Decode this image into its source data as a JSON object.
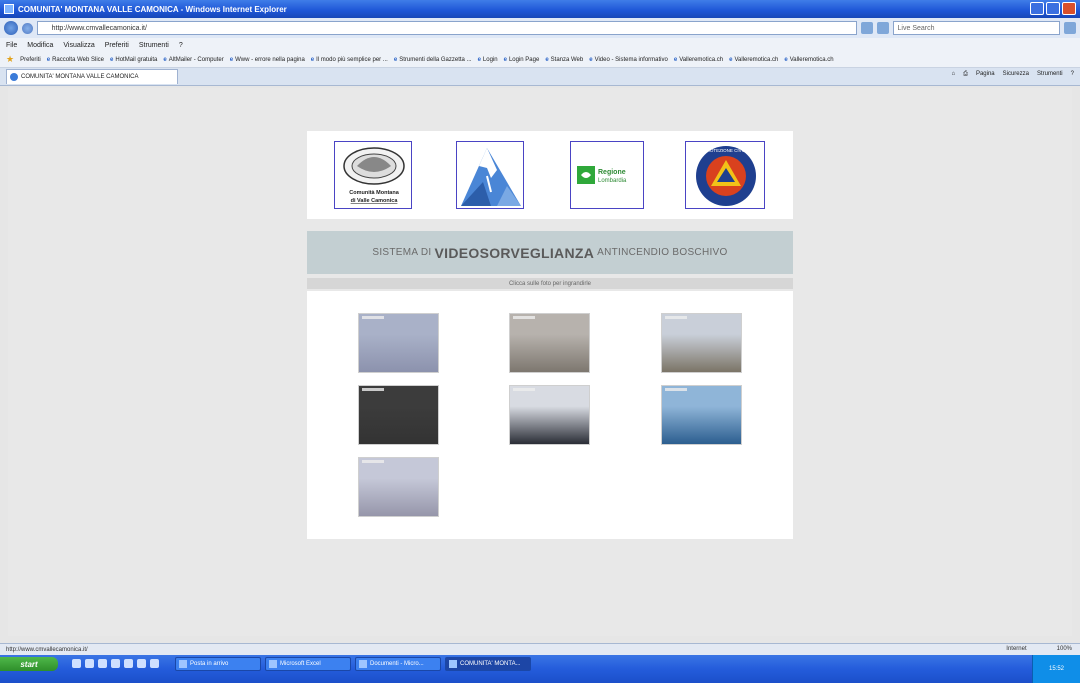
{
  "window": {
    "title": "COMUNITA' MONTANA VALLE CAMONICA - Windows Internet Explorer"
  },
  "address": {
    "url": "http://www.cmvallecamonica.it/",
    "search_placeholder": "Live Search"
  },
  "menu": [
    "File",
    "Modifica",
    "Visualizza",
    "Preferiti",
    "Strumenti",
    "?"
  ],
  "favorites": {
    "label": "Preferiti",
    "items": [
      "Raccolta Web Slice",
      "HotMail gratuita",
      "AltMailer - Computer",
      "Www - errore nella pagina",
      "Il modo più semplice per ...",
      "Strumenti della Gazzetta ...",
      "Login",
      "Login Page",
      "Stanza Web",
      "Video - Sistema informativo",
      "Valleremotica.ch",
      "Valleremotica.ch",
      "Valleremotica.ch"
    ]
  },
  "tab": {
    "label": "COMUNITA' MONTANA VALLE CAMONICA"
  },
  "command_bar": [
    "Pagina",
    "Sicurezza",
    "Strumenti"
  ],
  "page": {
    "banner": {
      "prefix": "SISTEMA DI",
      "emphasis": "VIDEOSORVEGLIANZA",
      "suffix": "ANTINCENDIO BOSCHIVO"
    },
    "hint": "Clicca sulle foto per ingrandirle",
    "logos": {
      "cm_line1": "Comunità Montana",
      "cm_line2": "di Valle Camonica",
      "rl_line1": "Regione",
      "rl_line2": "Lombardia",
      "pc_text": "PROTEZIONE CIVILE"
    },
    "cameras": [
      {
        "name": "camera-1",
        "sky": "#a9b1c8",
        "ground": "#8c92ad"
      },
      {
        "name": "camera-2",
        "sky": "#b7b2ad",
        "ground": "#7d776f"
      },
      {
        "name": "camera-3",
        "sky": "#c9cfd9",
        "ground": "#7b7466"
      },
      {
        "name": "camera-4",
        "sky": "#3c3c3c",
        "ground": "#333333"
      },
      {
        "name": "camera-5",
        "sky": "#d8dbe2",
        "ground": "#2a2d36"
      },
      {
        "name": "camera-6",
        "sky": "#8fb5d8",
        "ground": "#2c5e8f"
      },
      {
        "name": "camera-7",
        "sky": "#c5c8d8",
        "ground": "#9696aa"
      }
    ]
  },
  "status": {
    "text": "http://www.cmvallecamonica.it/",
    "zone": "Internet",
    "zoom": "100%"
  },
  "taskbar": {
    "start": "start",
    "tasks": [
      "Posta in arrivo",
      "Microsoft Excel",
      "Documenti - Micro...",
      "COMUNITA' MONTA..."
    ],
    "clock": "15:52"
  }
}
